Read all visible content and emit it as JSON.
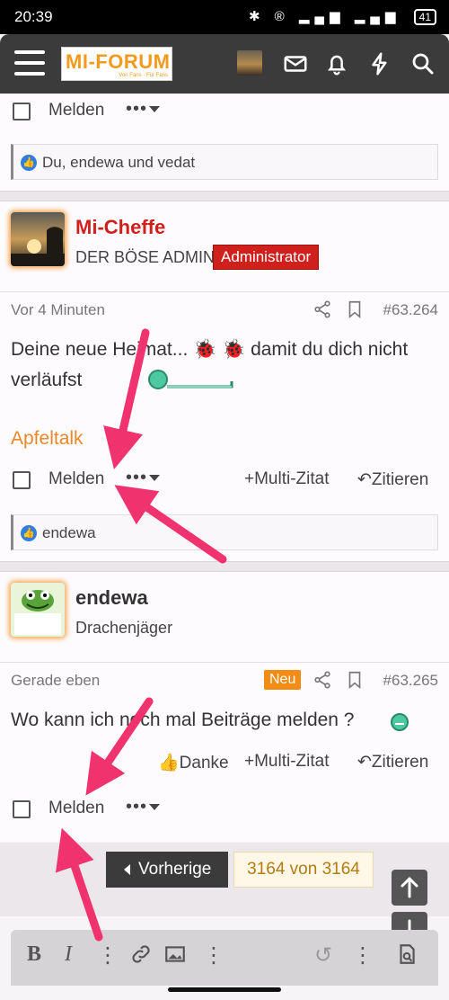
{
  "status_bar": {
    "time": "20:39",
    "icons_text": "✱ ® ▂▄▆ ▂▄▆",
    "battery": "41"
  },
  "header": {
    "logo_main": "MI-FORUM",
    "logo_sub": "Von Fans · Für Fans"
  },
  "prev_post": {
    "report_label": "Melden",
    "more": "•••",
    "likes_text": "Du, endewa und vedat"
  },
  "post1": {
    "username": "Mi-Cheffe",
    "user_title": "DER BÖSE ADMIN",
    "badge": "Administrator",
    "time": "Vor 4 Minuten",
    "post_number": "#63.264",
    "message": "Deine neue Heimat... 🐞 🐞 damit du dich nicht verläufst",
    "signature": "Apfeltalk",
    "report_label": "Melden",
    "more": "•••",
    "multiquote": "+Multi-Zitat",
    "quote": "↶Zitieren",
    "likes_text": "endewa"
  },
  "post2": {
    "username": "endewa",
    "user_title": "Drachenjäger",
    "time": "Gerade eben",
    "new_badge": "Neu",
    "post_number": "#63.265",
    "message": "Wo kann ich noch mal Beiträge melden ?",
    "thanks": "Danke",
    "multiquote": "+Multi-Zitat",
    "quote": "↶Zitieren",
    "report_label": "Melden",
    "more": "•••"
  },
  "pager": {
    "prev_label": "Vorherige",
    "page_count": "3164 von 3164"
  },
  "colors": {
    "accent_orange": "#f39a1e",
    "admin_red": "#d0201c",
    "arrow_pink": "#f0336e"
  }
}
